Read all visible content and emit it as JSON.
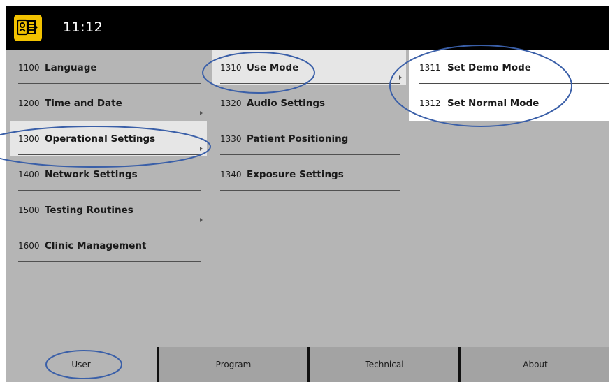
{
  "header": {
    "time": "11:12"
  },
  "menu_level1": [
    {
      "number": "1100",
      "label": "Language"
    },
    {
      "number": "1200",
      "label": "Time and Date"
    },
    {
      "number": "1300",
      "label": "Operational Settings"
    },
    {
      "number": "1400",
      "label": "Network Settings"
    },
    {
      "number": "1500",
      "label": "Testing Routines"
    },
    {
      "number": "1600",
      "label": "Clinic Management"
    }
  ],
  "menu_level2": [
    {
      "number": "1310",
      "label": "Use Mode"
    },
    {
      "number": "1320",
      "label": "Audio Settings"
    },
    {
      "number": "1330",
      "label": "Patient Positioning"
    },
    {
      "number": "1340",
      "label": "Exposure Settings"
    }
  ],
  "menu_level3": [
    {
      "number": "1311",
      "label": "Set Demo Mode"
    },
    {
      "number": "1312",
      "label": "Set Normal Mode"
    }
  ],
  "tabs": [
    {
      "label": "User"
    },
    {
      "label": "Program"
    },
    {
      "label": "Technical"
    },
    {
      "label": "About"
    }
  ],
  "colors": {
    "background": "#b5b5b5",
    "topbar": "#000000",
    "icon": "#f2c200",
    "highlight": "#e6e6e6",
    "submenu": "#ffffff",
    "annotation": "#3a5fa8"
  },
  "icons": {
    "app": "patient-id-icon",
    "submenu": "chevron-right-icon"
  }
}
